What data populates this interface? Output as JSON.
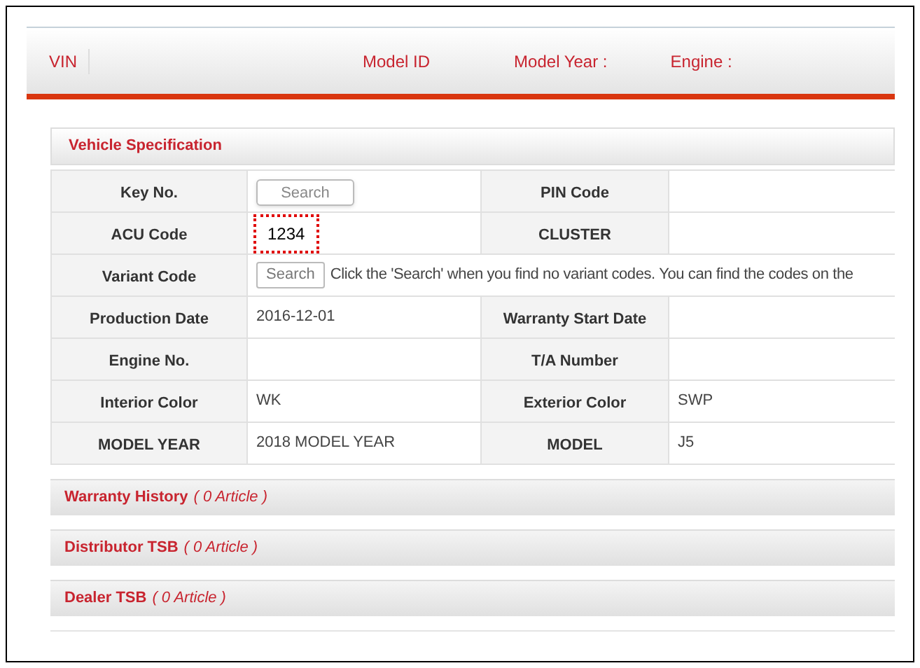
{
  "header": {
    "fields": [
      "VIN",
      "Model ID",
      "Model Year :",
      "Engine :"
    ]
  },
  "vehicle_specification": {
    "title": "Vehicle Specification",
    "rows": [
      {
        "label": "Key No.",
        "value": {
          "kind": "button",
          "text": "Search"
        },
        "label2": "PIN Code",
        "value2": {
          "kind": "empty"
        }
      },
      {
        "label": "ACU Code",
        "value": {
          "kind": "highlighted",
          "text": "1234"
        },
        "label2": "CLUSTER",
        "value2": {
          "kind": "empty"
        }
      },
      {
        "label": "Variant Code",
        "value": {
          "kind": "button_note",
          "text": "Search",
          "note": "Click the 'Search' when you find no variant codes. You can find the codes on the"
        }
      },
      {
        "label": "Production Date",
        "value": {
          "kind": "text",
          "text": "2016-12-01"
        },
        "label2": "Warranty Start Date",
        "value2": {
          "kind": "empty"
        }
      },
      {
        "label": "Engine No.",
        "value": {
          "kind": "empty"
        },
        "label2": "T/A Number",
        "value2": {
          "kind": "empty"
        }
      },
      {
        "label": "Interior Color",
        "value": {
          "kind": "text",
          "text": "WK"
        },
        "label2": "Exterior Color",
        "value2": {
          "kind": "text",
          "text": "SWP"
        }
      },
      {
        "label": "MODEL YEAR",
        "value": {
          "kind": "text",
          "text": "2018 MODEL YEAR"
        },
        "label2": "MODEL",
        "value2": {
          "kind": "text",
          "text": "J5"
        }
      }
    ]
  },
  "sections": [
    {
      "title": "Warranty History",
      "count": "( 0 Article )"
    },
    {
      "title": "Distributor TSB",
      "count": "( 0 Article )"
    },
    {
      "title": "Dealer TSB",
      "count": "( 0 Article )"
    }
  ]
}
